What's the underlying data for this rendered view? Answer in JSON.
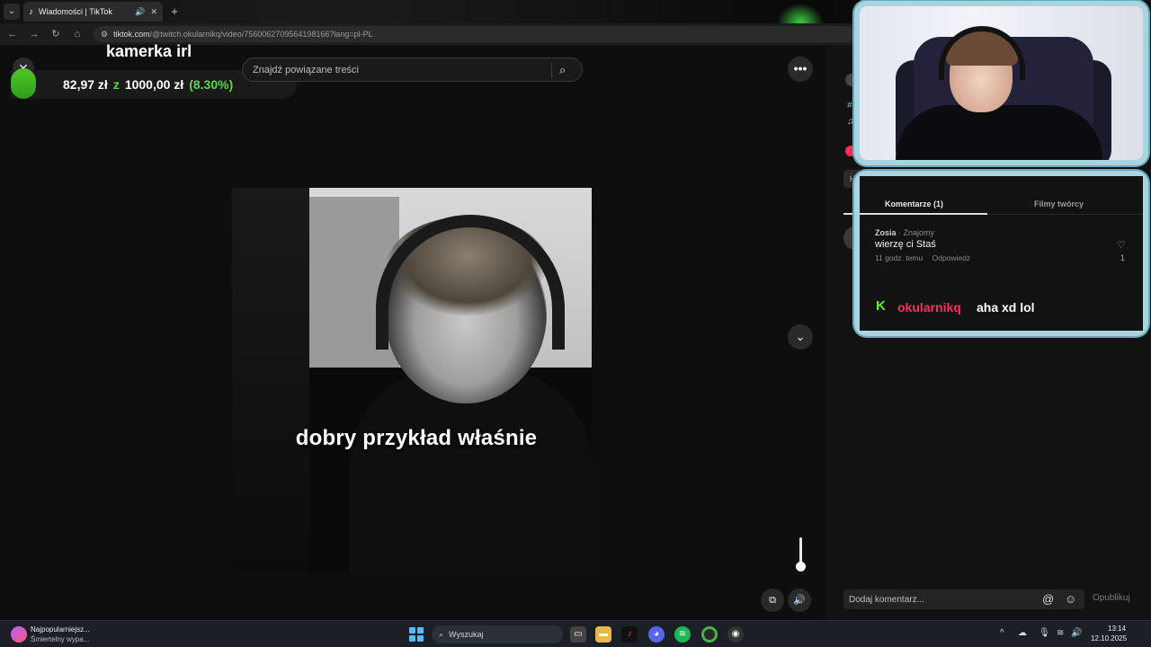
{
  "browser": {
    "tab_title": "Wiadomości | TikTok",
    "url_domain": "tiktok.com",
    "url_path": "/@twitch.okularnikq/video/7560062709564198166?lang=pl-PL"
  },
  "overlay": {
    "stream_title": "kamerka irl",
    "price_current": "82,97 zł",
    "price_separator": "z",
    "price_goal": "1000,00 zł",
    "price_percent": "(8.30%)"
  },
  "video": {
    "search_placeholder": "Znajdź powiązane treści",
    "caption": "dobry przykład właśnie",
    "volume": 0.1
  },
  "comments": {
    "tab_active": "Komentarze (1)",
    "tab_other": "Filmy twórcy",
    "items": [
      {
        "user": "Zosia",
        "relation": "· Znajomy",
        "text": "wierzę ci Staś",
        "time": "11 godz. temu",
        "reply": "Odpowiedz",
        "likes": "1"
      }
    ],
    "input_placeholder": "Dodaj komentarz...",
    "publish_label": "Opublikuj"
  },
  "kick_chat": {
    "logo": "K",
    "user": "okularnikq",
    "message": "aha xd lol"
  },
  "taskbar": {
    "news_title": "Najpopularniejsz...",
    "news_sub": "Śmiertelny wypa...",
    "search_label": "Wyszukaj",
    "time": "13:14",
    "date": "12.10.2025"
  },
  "colors": {
    "accent_green": "#5dd64a",
    "kick_green": "#53fc18",
    "kick_user": "#ff2d5f",
    "frame_ice": "#a9d3df"
  }
}
